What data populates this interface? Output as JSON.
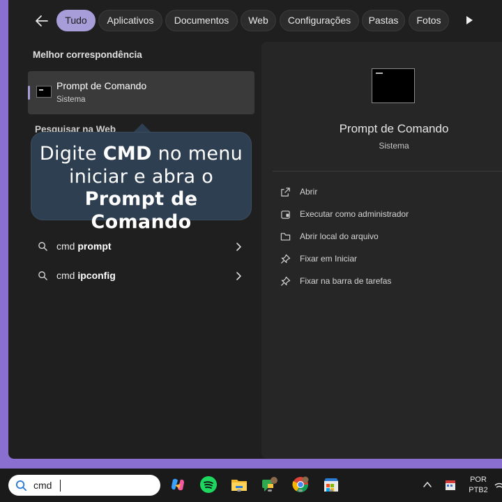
{
  "filters": {
    "back_icon": "back-arrow-icon",
    "tabs": [
      {
        "label": "Tudo",
        "active": true
      },
      {
        "label": "Aplicativos"
      },
      {
        "label": "Documentos"
      },
      {
        "label": "Web"
      },
      {
        "label": "Configurações"
      },
      {
        "label": "Pastas"
      },
      {
        "label": "Fotos"
      }
    ],
    "more_icon": "play-more-icon"
  },
  "best_match": {
    "heading": "Melhor correspondência",
    "name": "Prompt de Comando",
    "subtitle": "Sistema",
    "icon": "terminal-icon"
  },
  "web_search": {
    "heading": "Pesquisar na Web",
    "results": [
      {
        "prefix": "cmd",
        "bold": "prompt"
      },
      {
        "prefix": "cmd",
        "bold": "ipconfig"
      }
    ]
  },
  "callout": {
    "line1_pre": "Digite ",
    "line1_bold": "CMD",
    "line1_post": " no menu",
    "line2": "iniciar e abra o",
    "line3_bold": "Prompt de Comando"
  },
  "detail": {
    "title": "Prompt de Comando",
    "subtitle": "Sistema",
    "actions": [
      {
        "label": "Abrir",
        "icon": "open-external-icon"
      },
      {
        "label": "Executar como administrador",
        "icon": "shield-admin-icon"
      },
      {
        "label": "Abrir local do arquivo",
        "icon": "folder-icon"
      },
      {
        "label": "Fixar em Iniciar",
        "icon": "pin-icon"
      },
      {
        "label": "Fixar na barra de tarefas",
        "icon": "pin-icon"
      }
    ]
  },
  "taskbar": {
    "search_value": "cmd",
    "apps": [
      "copilot-icon",
      "spotify-icon",
      "file-explorer-icon",
      "chat-app-icon",
      "chrome-icon",
      "store-icon"
    ],
    "lang_line1": "POR",
    "lang_line2": "PTB2"
  },
  "colors": {
    "accent": "#a79dd9",
    "background": "#8a6fd0",
    "panel": "#1f1f1f",
    "callout": "#2f3f52"
  }
}
